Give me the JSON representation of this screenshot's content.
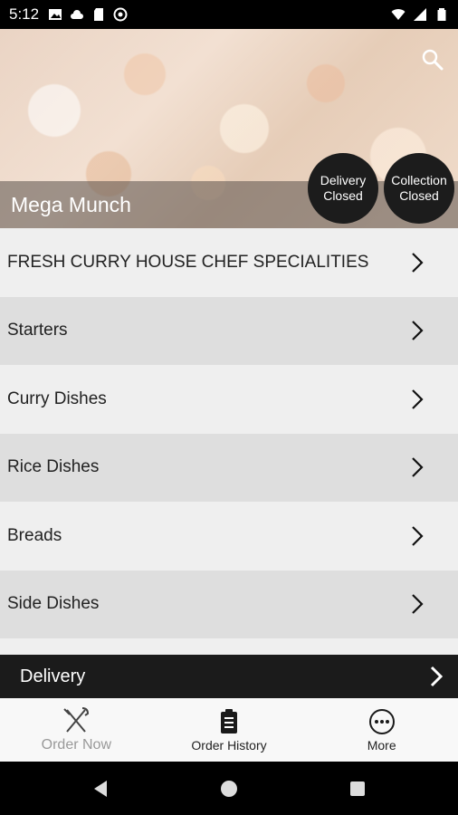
{
  "status_bar": {
    "time": "5:12"
  },
  "hero": {
    "restaurant_name": "Mega Munch",
    "delivery_badge": {
      "line1": "Delivery",
      "line2": "Closed"
    },
    "collection_badge": {
      "line1": "Collection",
      "line2": "Closed"
    }
  },
  "menu": {
    "items": [
      {
        "label": "FRESH CURRY HOUSE CHEF SPECIALITIES"
      },
      {
        "label": "Starters"
      },
      {
        "label": "Curry Dishes"
      },
      {
        "label": "Rice Dishes"
      },
      {
        "label": "Breads"
      },
      {
        "label": "Side Dishes"
      }
    ]
  },
  "delivery_bar": {
    "label": "Delivery"
  },
  "bottom_nav": {
    "order_now": "Order Now",
    "order_history": "Order History",
    "more": "More"
  },
  "colors": {
    "badge_bg": "#1c1c1c",
    "delivery_bar_bg": "#1b1b1b",
    "row_light": "#efefef",
    "row_dark": "#dedede"
  }
}
